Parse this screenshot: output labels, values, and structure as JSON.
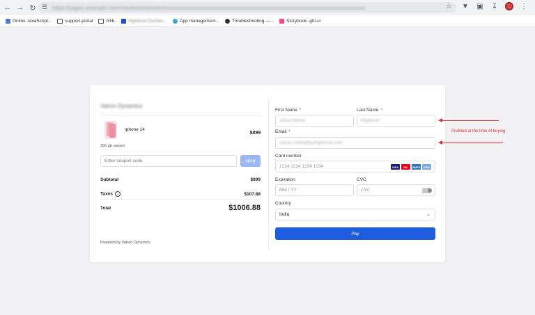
{
  "browser": {
    "url": "https://pages.example.com/checkout/session/xxxxxxxxxxxxxxxxxxxxxxxxxxxxxxxxxxxxxxxxxxxxxxxxxxxxxxxxxxxxxxxxxxxxxxxx",
    "bookmarks": [
      {
        "label": "Online JavaScript...",
        "icon": "js-icon",
        "color": "#4a7bd8"
      },
      {
        "label": "support-portal",
        "icon": "folder-icon",
        "color": "#555555"
      },
      {
        "label": "GHL",
        "icon": "folder-icon",
        "color": "#555555"
      },
      {
        "label": "Highlevel Dashbo...",
        "icon": "app-icon",
        "color": "#1d4ed8"
      },
      {
        "label": "App management...",
        "icon": "gear-icon",
        "color": "#3aa0e0"
      },
      {
        "label": "Troubleshooting —...",
        "icon": "notion-icon",
        "color": "#333333"
      },
      {
        "label": "Storybook -ghl-ui",
        "icon": "storybook-icon",
        "color": "#ff4785"
      }
    ]
  },
  "summary": {
    "merchant": "Vatron Dynamics",
    "product_name": "Iphone 14",
    "product_price": "$899",
    "variant": "256 gb variant",
    "coupon_placeholder": "Enter coupon code",
    "apply_label": "Apply",
    "subtotal_label": "Subtotal",
    "subtotal_value": "$899",
    "taxes_label": "Taxes",
    "taxes_value": "$107.88",
    "total_label": "Total",
    "total_value": "$1006.88",
    "powered_by": "Powered by Vatron Dynamics"
  },
  "form": {
    "first_name_label": "First Name",
    "first_name_value": "Vatsal Mehta",
    "last_name_label": "Last Name",
    "last_name_value": "Highlevel",
    "email_label": "Email",
    "email_value": "vatsal.mehta@gohighlevel.com",
    "required_mark": "*",
    "card_label": "Card number",
    "card_placeholder": "1234 1234 1234 1234",
    "card_brands": [
      "VISA",
      "MC",
      "AMEX",
      "DISC"
    ],
    "expiration_label": "Expiration",
    "expiration_placeholder": "MM / YY",
    "cvc_label": "CVC",
    "cvc_placeholder": "CVC",
    "country_label": "Country",
    "country_value": "India",
    "pay_label": "Pay"
  },
  "annotation": {
    "text": "Prefilled at the time of buying",
    "color": "#e0302f"
  },
  "colors": {
    "primary": "#1f5de0",
    "apply": "#9bb6f4",
    "required": "#e4474b"
  }
}
